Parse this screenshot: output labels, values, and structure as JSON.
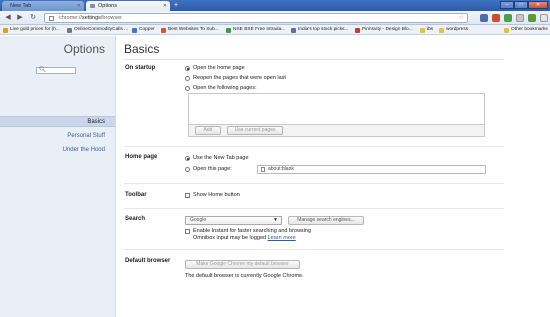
{
  "tabs": [
    {
      "label": "New Tab"
    },
    {
      "label": "Options"
    }
  ],
  "toolbar": {
    "url_scheme": "chrome://",
    "url_host": "settings",
    "url_path": "/browser"
  },
  "bookmarks": [
    {
      "label": "Live gold prices for (h...",
      "color": "#d8a21f"
    },
    {
      "label": "OnlineCommodityCalls ...",
      "color": "#6c7a90"
    },
    {
      "label": "Copper",
      "color": "#3f78c8"
    },
    {
      "label": "Best Websites To Sub...",
      "color": "#d05a2c"
    },
    {
      "label": "NSE BSE Free Intrada...",
      "color": "#3a9a4a"
    },
    {
      "label": "India's top stock picks...",
      "color": "#6b6b9b"
    },
    {
      "label": "Pinnsvity - Design Blo...",
      "color": "#c23c2c"
    },
    {
      "label": "ibs",
      "color": "#e0c14a"
    },
    {
      "label": "wordpress",
      "color": "#e0c14a"
    },
    {
      "label": "Other bookmarks",
      "color": "#e0c14a"
    }
  ],
  "sidebar": {
    "title": "Options",
    "items": [
      {
        "label": "Basics"
      },
      {
        "label": "Personal Stuff"
      },
      {
        "label": "Under the Hood"
      }
    ]
  },
  "main": {
    "title": "Basics",
    "startup": {
      "label": "On startup",
      "options": [
        {
          "label": "Open the home page",
          "checked": true
        },
        {
          "label": "Reopen the pages that were open last",
          "checked": false
        },
        {
          "label": "Open the following pages:",
          "checked": false
        }
      ],
      "add_button": "Add",
      "use_current_button": "Use current pages"
    },
    "homepage": {
      "label": "Home page",
      "options": [
        {
          "label": "Use the New Tab page",
          "checked": true
        },
        {
          "label": "Open this page:",
          "checked": false
        }
      ],
      "url_value": "about:blank"
    },
    "toolbar_section": {
      "label": "Toolbar",
      "show_home_label": "Show Home button"
    },
    "search": {
      "label": "Search",
      "engine": "Google",
      "manage_button": "Manage search engines...",
      "instant_label": "Enable Instant for faster searching and browsing",
      "instant_note": "Omnibox input may be logged",
      "learn_more": "Learn more"
    },
    "default_browser": {
      "label": "Default browser",
      "button": "Make Google Chrome my default browser",
      "status": "The default browser is currently Google Chrome."
    }
  }
}
